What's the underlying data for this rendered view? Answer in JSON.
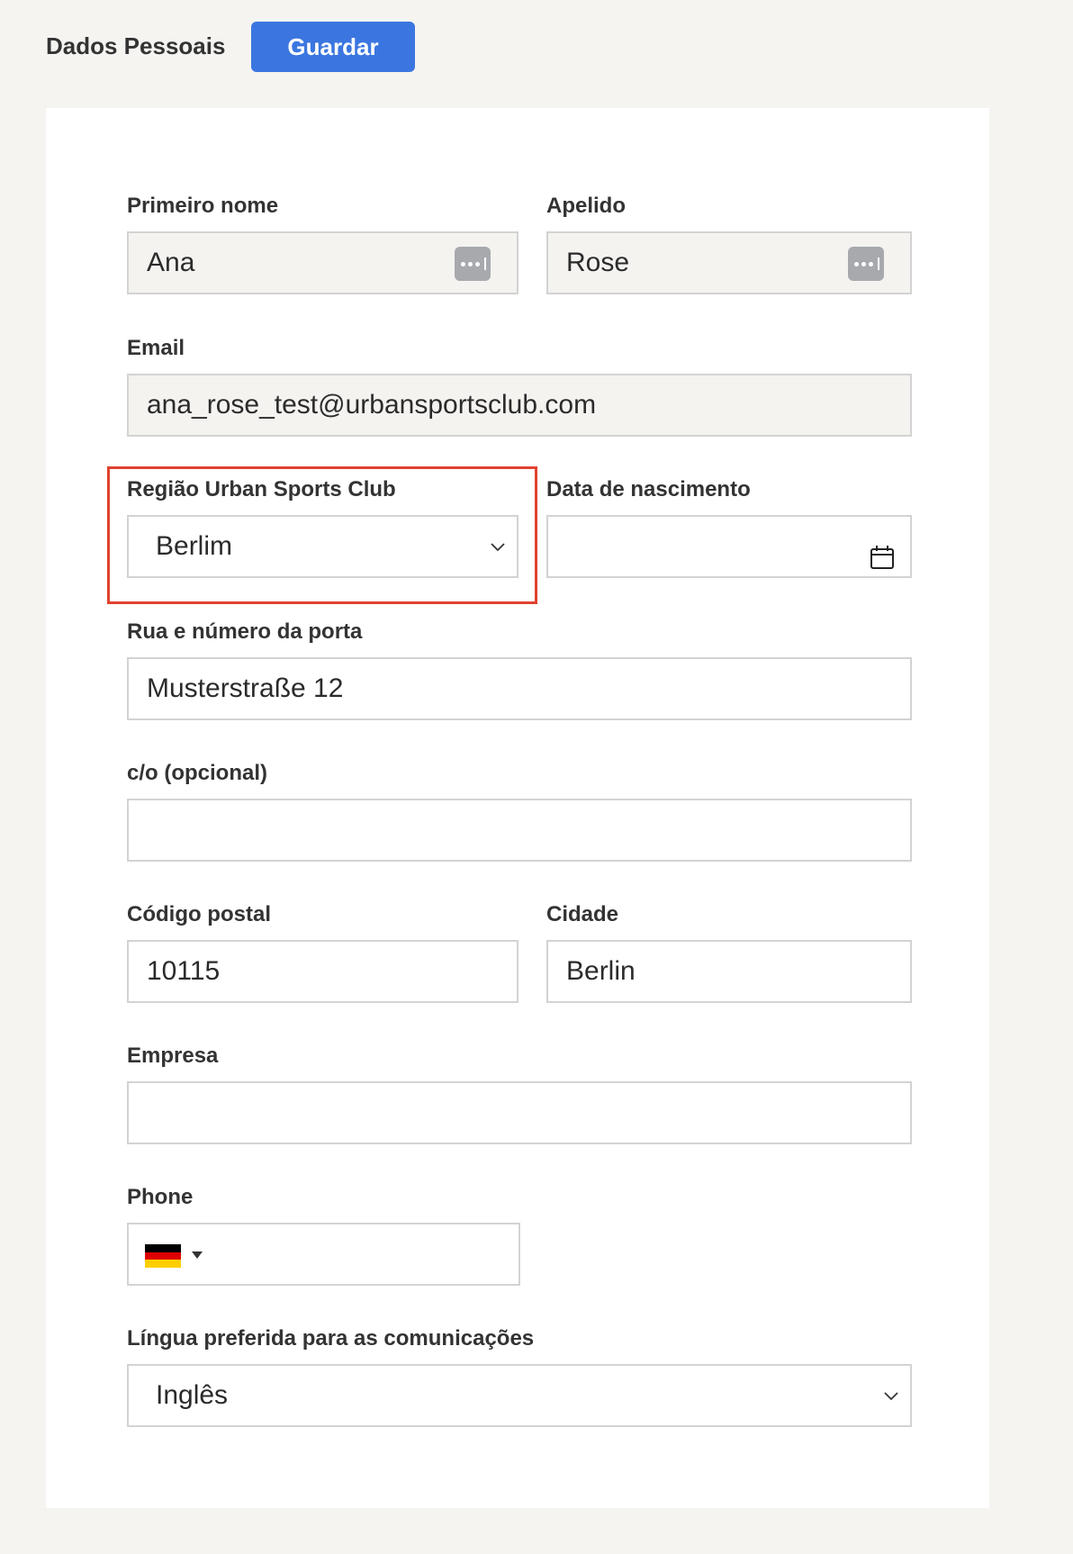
{
  "header": {
    "title": "Dados Pessoais",
    "save_label": "Guardar",
    "accent": "#3b76e0"
  },
  "form": {
    "first_name": {
      "label": "Primeiro nome",
      "value": "Ana"
    },
    "last_name": {
      "label": "Apelido",
      "value": "Rose"
    },
    "email": {
      "label": "Email",
      "value": "ana_rose_test@urbansportsclub.com"
    },
    "region": {
      "label": "Região Urban Sports Club",
      "value": "Berlim"
    },
    "birth_date": {
      "label": "Data de nascimento",
      "value": ""
    },
    "street": {
      "label": "Rua e número da porta",
      "value": "Musterstraße 12"
    },
    "co": {
      "label": "c/o (opcional)",
      "value": ""
    },
    "postal_code": {
      "label": "Código postal",
      "value": "10115"
    },
    "city": {
      "label": "Cidade",
      "value": "Berlin"
    },
    "company": {
      "label": "Empresa",
      "value": ""
    },
    "phone": {
      "label": "Phone",
      "value": "",
      "country_flag": "germany-flag-icon"
    },
    "language": {
      "label": "Língua preferida para as comunicações",
      "value": "Inglês"
    }
  },
  "highlight_color": "#e0432f"
}
